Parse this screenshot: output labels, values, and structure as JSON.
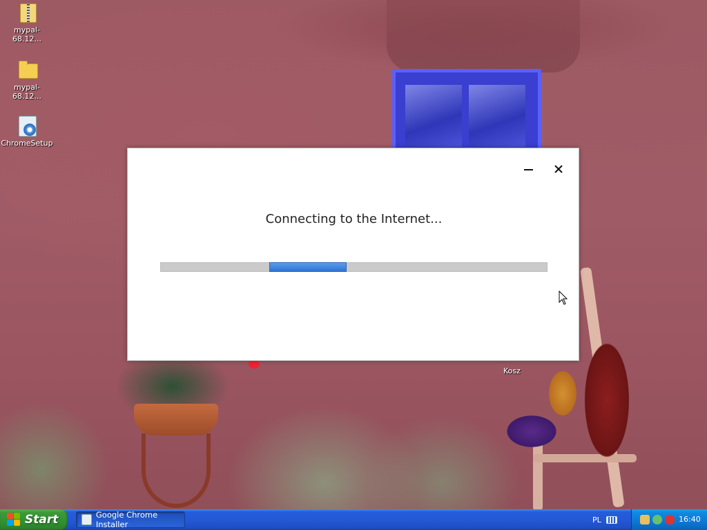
{
  "desktop": {
    "icons": [
      {
        "label": "mypal-68.12...",
        "icon": "zip-folder-icon"
      },
      {
        "label": "mypal-68.12...",
        "icon": "folder-icon"
      },
      {
        "label": "ChromeSetup",
        "icon": "installer-icon"
      }
    ],
    "recycle_bin_label": "Kosz"
  },
  "dialog": {
    "message": "Connecting to the Internet...",
    "progress": {
      "state": "indeterminate",
      "chunk_start_fraction": 0.28,
      "chunk_width_fraction": 0.2,
      "color": "#3b82e0"
    }
  },
  "taskbar": {
    "start_label": "Start",
    "task_button_label": "Google Chrome Installer",
    "language": "PL",
    "clock": "16:40"
  }
}
